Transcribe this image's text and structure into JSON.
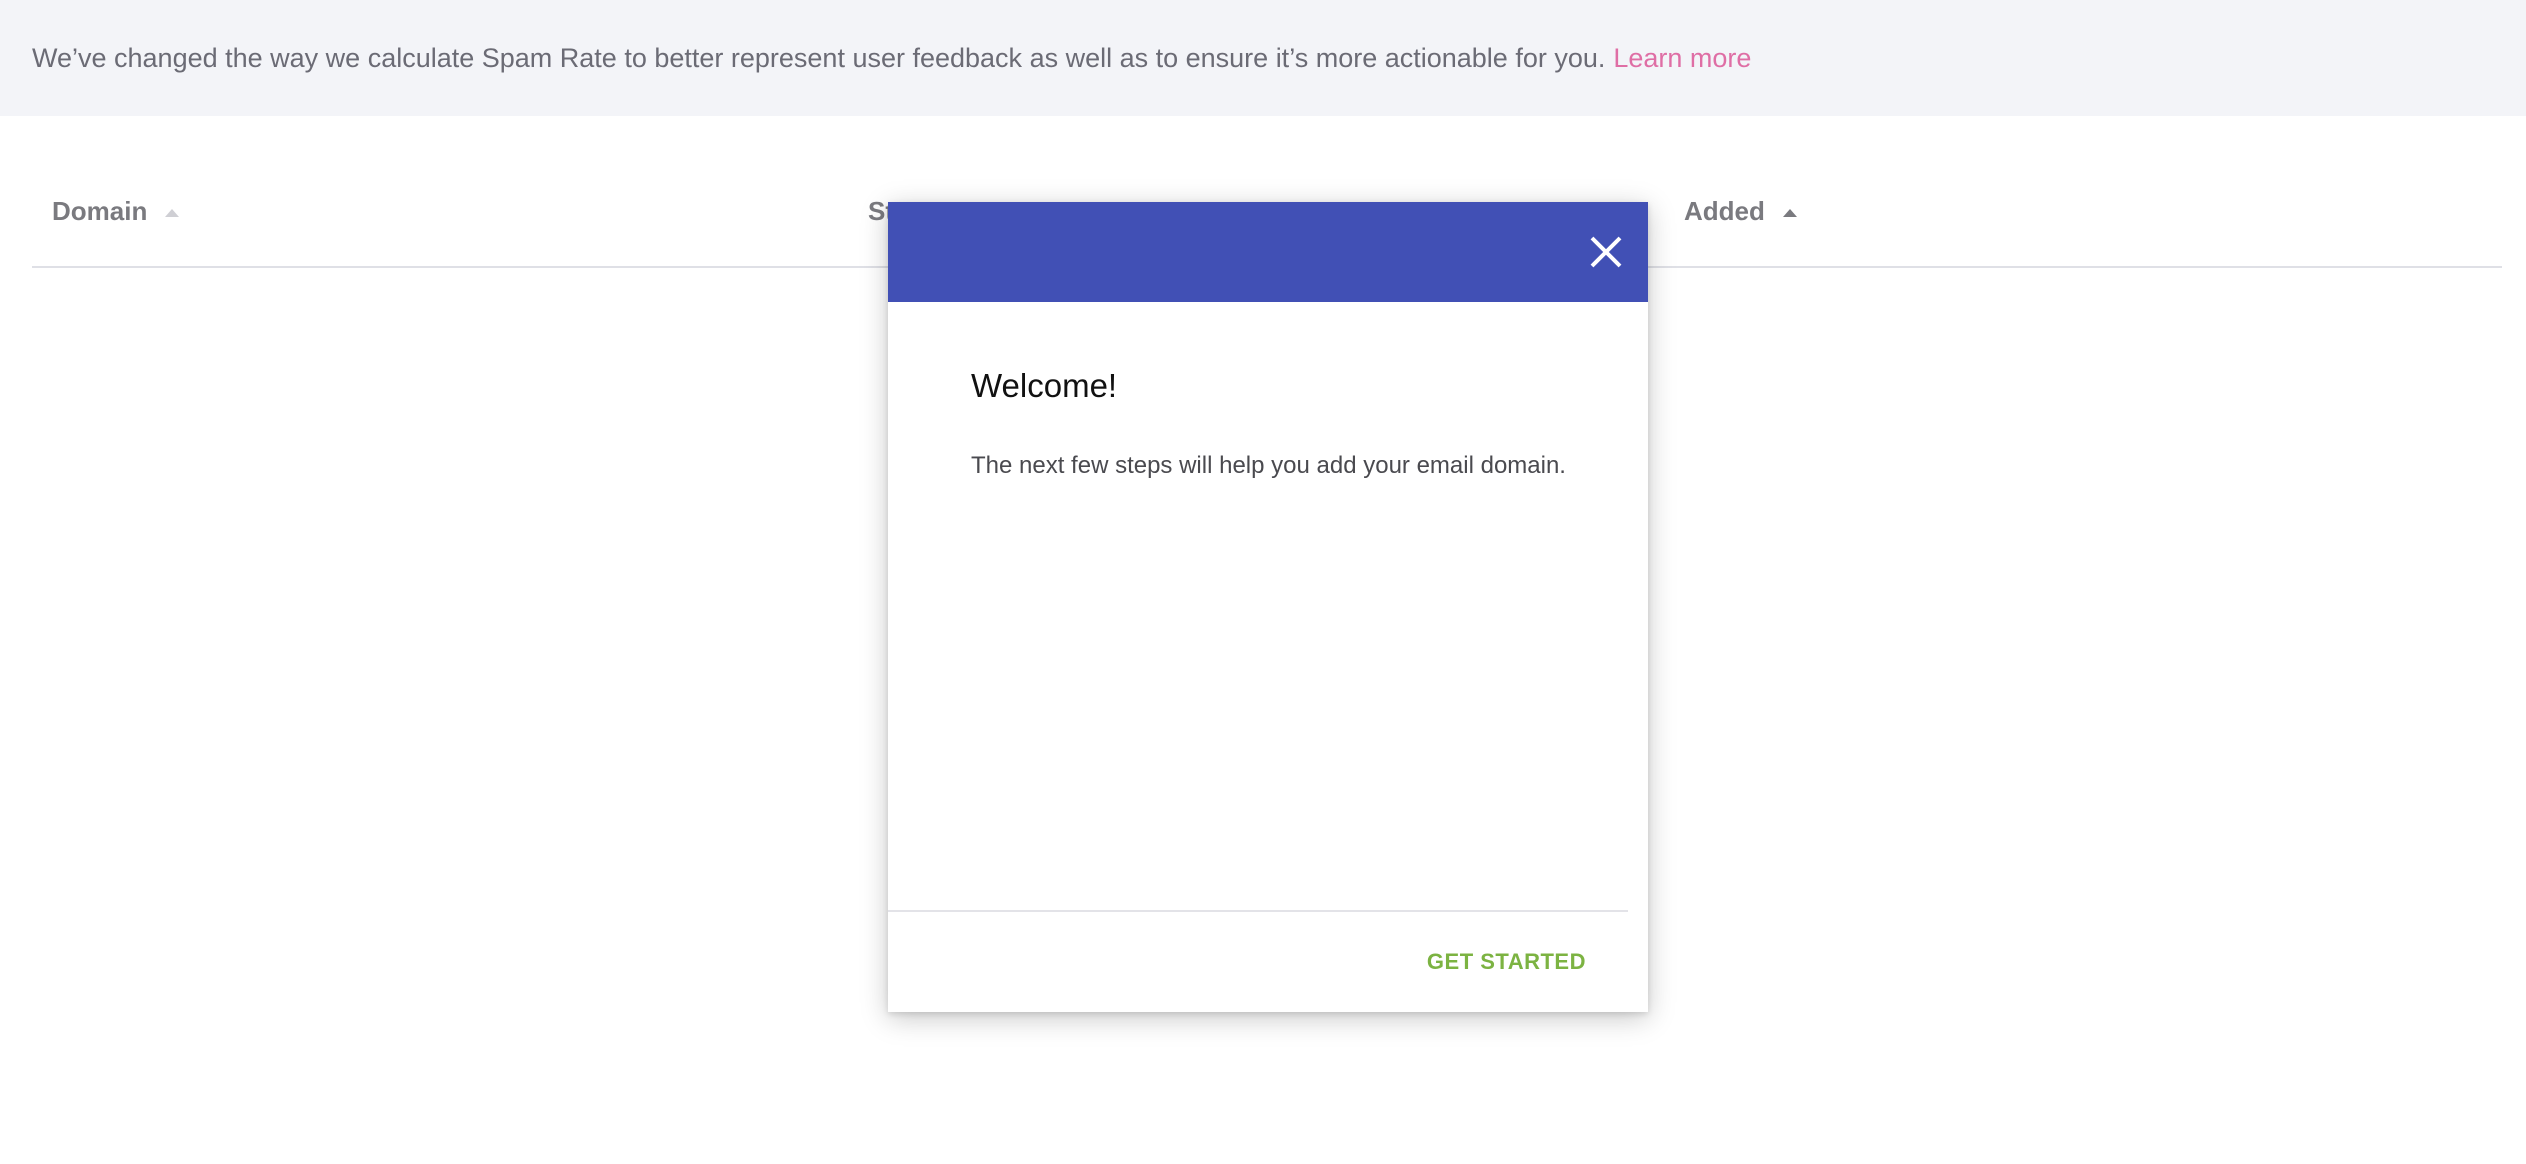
{
  "banner": {
    "message": "We’ve changed the way we calculate Spam Rate to better represent user feedback as well as to ensure it’s more actionable for you.",
    "link_label": "Learn more",
    "link_color": "#df6ea5"
  },
  "table": {
    "columns": [
      {
        "label": "Domain",
        "sort": "ascending",
        "active": false
      },
      {
        "label": "St",
        "sort": "none",
        "active": false
      },
      {
        "label": "Added",
        "sort": "ascending",
        "active": true
      }
    ]
  },
  "modal": {
    "header_color": "#4150b5",
    "close_icon": "close-icon",
    "title": "Welcome!",
    "body": "The next few steps will help you add your email domain.",
    "primary_action": "GET STARTED",
    "primary_color": "#7cb342"
  }
}
